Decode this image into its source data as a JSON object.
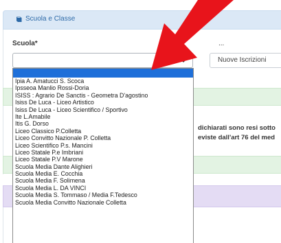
{
  "panel": {
    "title": "Scuola e Classe",
    "icon": "book-icon"
  },
  "form": {
    "scuola_label": "Scuola*",
    "scuola_value": "",
    "tipo_value": "Nuove Iscrizioni"
  },
  "notice": {
    "line1": "dichiarati sono resi sotto",
    "line2": "eviste dall'art 76 del med"
  },
  "dropdown": {
    "options": [
      "",
      "Ipia A. Amatucci S. Scoca",
      "Ipsseoa Manlio Rossi-Doria",
      "ISISS : Agrario De Sanctis - Geometra D'agostino",
      "Isiss De Luca - Liceo Artistico",
      "Isiss De Luca - Liceo Scientifico / Sportivo",
      "Ite L.Amabile",
      "Itis G. Dorso",
      "Liceo Classico P.Colletta",
      "Liceo Convitto Nazionale P. Colletta",
      "Liceo Scientifico P.s. Mancini",
      "Liceo Statale P.e Imbriani",
      "Liceo Statale P.V Marone",
      "Scuola Media Dante Alighieri",
      "Scuola Media E. Cocchia",
      "Scuola Media F. Solimena",
      "Scuola Media L. DA VINCI",
      "Scuola Media S. Tommaso / Media F.Tedesco",
      "Scuola Media Convitto Nazionale Colletta"
    ]
  },
  "colors": {
    "panel_header": "#dbe8f6",
    "panel_title": "#2d6aa8",
    "success_band": "#e3f3e3",
    "purple_band": "#e4dcf4",
    "selected_option": "#1e6fd9",
    "annotation_arrow": "#e8141b"
  }
}
